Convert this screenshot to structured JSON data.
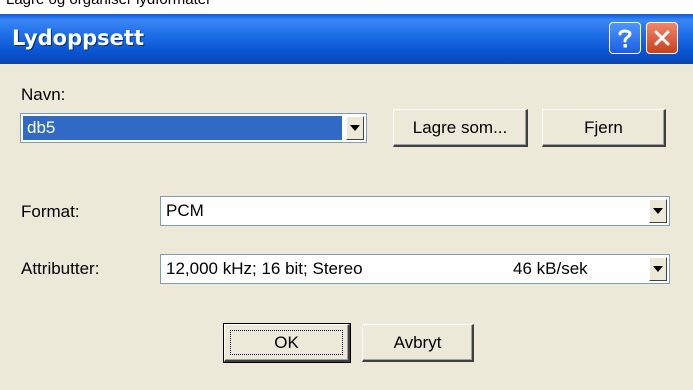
{
  "behind_window_text": "Lagre og organiser lydformater",
  "dialog": {
    "title": "Lydoppsett"
  },
  "name_section": {
    "label": "Navn:",
    "selected_value": "db5",
    "save_as_label": "Lagre som...",
    "remove_label": "Fjern"
  },
  "format": {
    "label": "Format:",
    "value": "PCM"
  },
  "attributes": {
    "label": "Attributter:",
    "value": "12,000 kHz; 16 bit; Stereo",
    "rate": "46 kB/sek"
  },
  "buttons": {
    "ok": "OK",
    "cancel": "Avbryt"
  },
  "colors": {
    "titlebar": "#0a55d2",
    "dialog_bg": "#ece9d8",
    "selection": "#316ac5",
    "close_button": "#c9401c"
  },
  "icons": {
    "help": "question-mark-icon",
    "close": "close-x-icon",
    "dropdown": "chevron-down-icon"
  }
}
